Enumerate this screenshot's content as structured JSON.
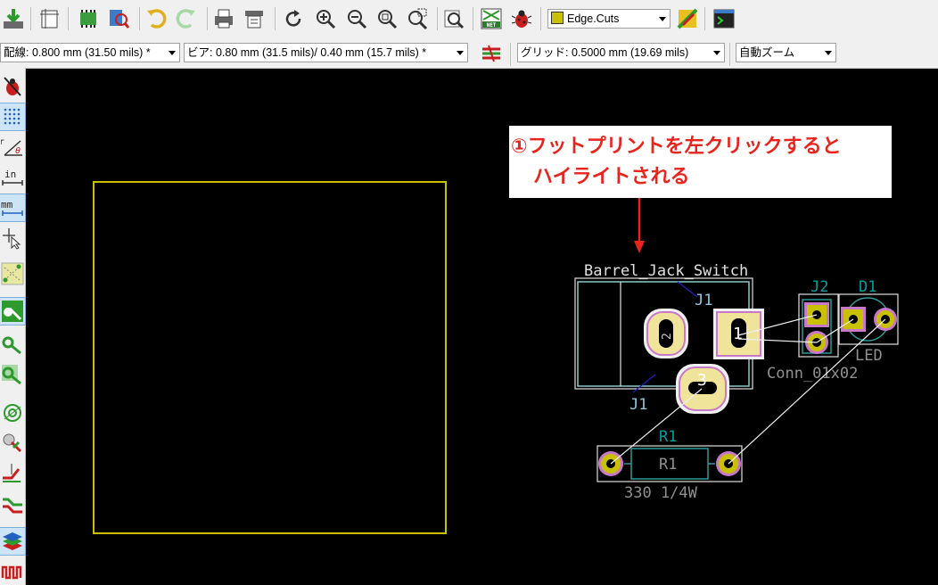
{
  "toolbar": {
    "layer_select": "Edge.Cuts",
    "layer_color": "#c8c000"
  },
  "toolbar2": {
    "track_width": "配線: 0.800 mm (31.50 mils) *",
    "via_size": "ビア: 0.80 mm (31.5 mils)/ 0.40 mm (15.7 mils) *",
    "grid": "グリッド: 0.5000 mm (19.69 mils)",
    "zoom": "自動ズーム"
  },
  "annotation": {
    "line1": "①フットプリントを左クリックすると",
    "line2": "ハイライトされる",
    "color": "#e8241c"
  },
  "pcb": {
    "barrel_ref": "Barrel_Jack_Switch",
    "j1_label": "J1",
    "j1_bottom_label": "J1",
    "pad1": "1",
    "pad2": "2",
    "pad3": "3",
    "j2_label": "J2",
    "d1_label": "D1",
    "led_value": "LED",
    "conn_value": "Conn_01x02",
    "r1_ref": "R1",
    "r1_silk": "R1",
    "r1_value": "330 1/4W",
    "edge_color": "#c8c000",
    "pad_color": "#f0e49a",
    "ref_color": "#00a0a0"
  }
}
